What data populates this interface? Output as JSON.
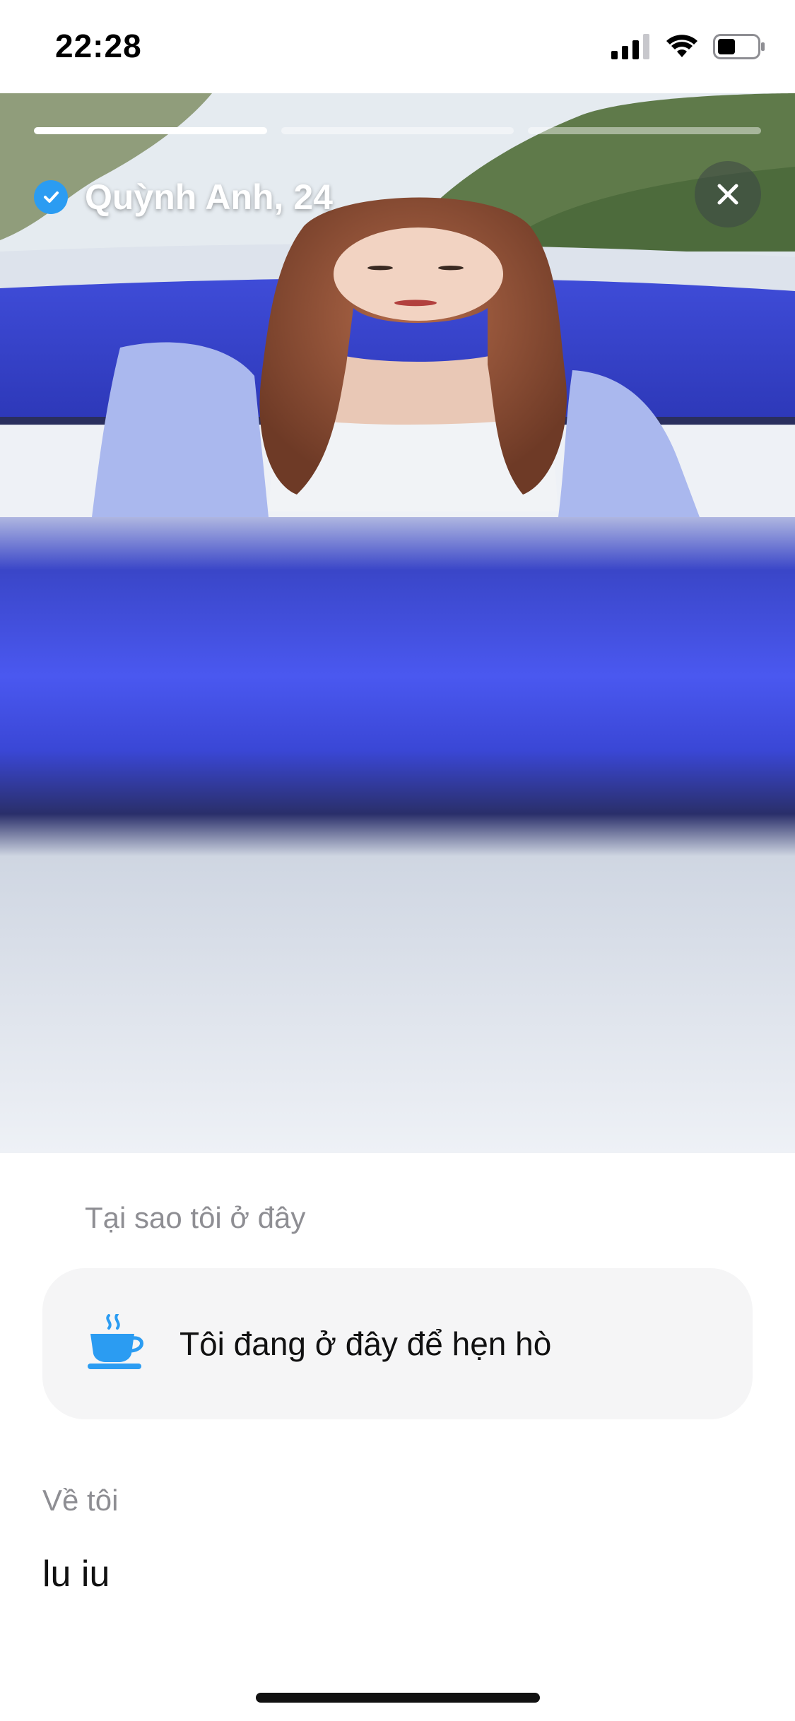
{
  "status_bar": {
    "time": "22:28"
  },
  "photos": {
    "count": 3,
    "active_index": 0
  },
  "profile": {
    "name_age": "Quỳnh Anh, 24",
    "verified": true
  },
  "why_here": {
    "label": "Tại sao tôi ở đây",
    "icon": "coffee-cup-icon",
    "text": "Tôi đang ở đây để hẹn hò"
  },
  "about": {
    "label": "Về tôi",
    "text": "lu iu"
  },
  "colors": {
    "accent_blue": "#2b9cf2",
    "card_bg": "#f5f5f6",
    "muted_text": "#8e8e93"
  }
}
